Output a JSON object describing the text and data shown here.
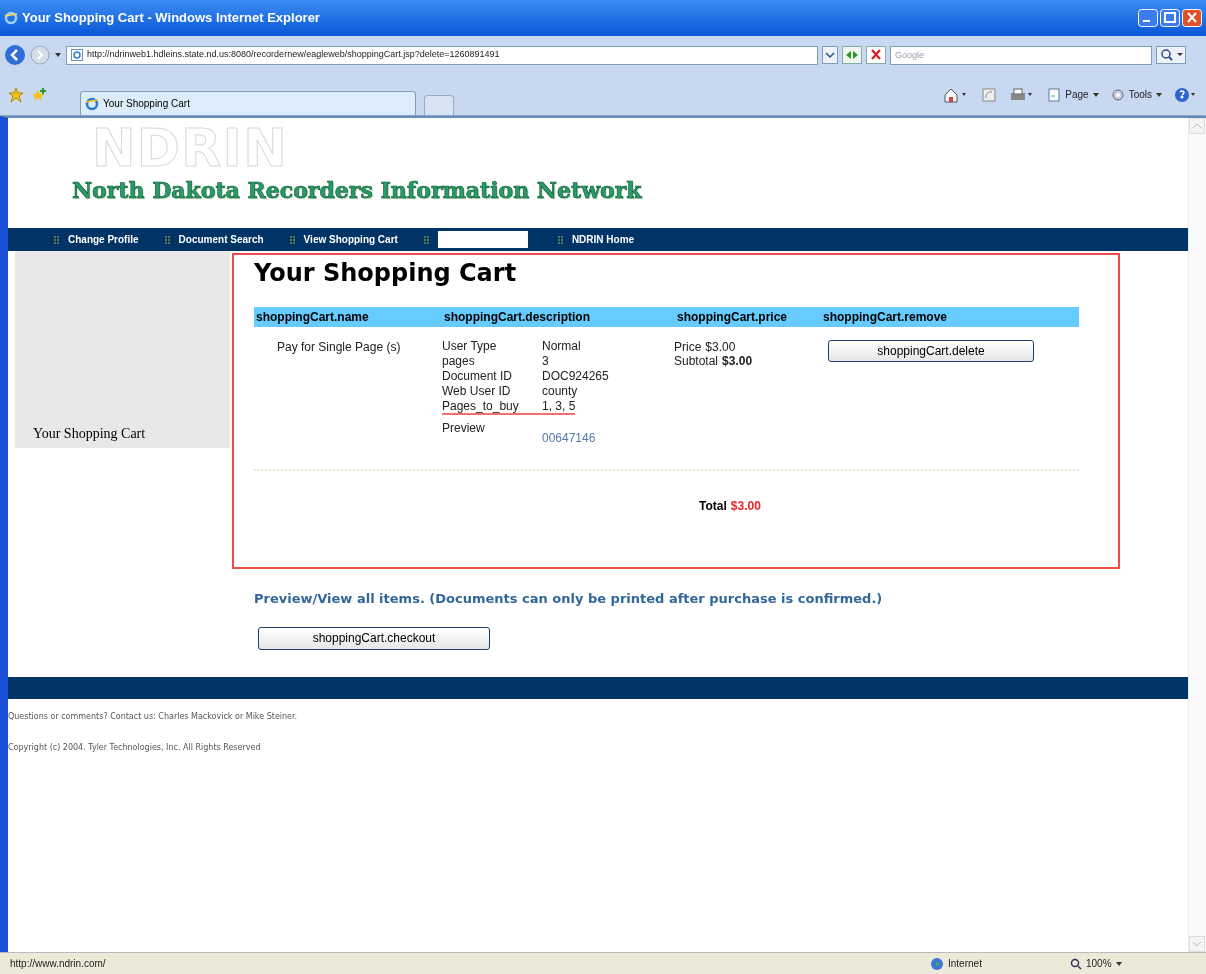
{
  "window": {
    "title": "Your Shopping Cart - Windows Internet Explorer"
  },
  "toolbar": {
    "address": "http://ndrinweb1.hdleins.state.nd.us:8080/recordernew/eagleweb/shoppingCart.jsp?delete=1260891491",
    "search_placeholder": "Google"
  },
  "tabs": [
    {
      "label": "Your Shopping Cart",
      "selected": true
    }
  ],
  "commands": [
    "Page",
    "Tools"
  ],
  "site": {
    "logo_mark": "NDRIN",
    "title": "North Dakota Recorders Information Network"
  },
  "nav": [
    {
      "kind": "link",
      "label": "Change Profile"
    },
    {
      "kind": "link",
      "label": "Document Search"
    },
    {
      "kind": "link",
      "label": "View Shopping Cart"
    },
    {
      "kind": "blank"
    },
    {
      "kind": "link",
      "label": "NDRIN Home"
    }
  ],
  "sidebar": {
    "label": "Your Shopping Cart"
  },
  "cart": {
    "heading": "Your Shopping Cart",
    "columns": [
      "shoppingCart.name",
      "shoppingCart.description",
      "shoppingCart.price",
      "shoppingCart.remove"
    ],
    "items": [
      {
        "name": "Pay for Single Page (s)",
        "details": [
          {
            "label": "User Type",
            "value": "Normal",
            "underlined": false
          },
          {
            "label": "pages",
            "value": "3",
            "underlined": false
          },
          {
            "label": "Document ID",
            "value": "DOC924265",
            "underlined": false
          },
          {
            "label": "Web User ID",
            "value": "county",
            "underlined": false
          },
          {
            "label": "Pages_to_buy",
            "value": "1, 3, 5",
            "underlined": true
          }
        ],
        "preview_label": "Preview",
        "preview_link": "00647146",
        "price_label": "Price",
        "price": "$3.00",
        "subtotal_label": "Subtotal",
        "subtotal": "$3.00",
        "button": "shoppingCart.delete"
      }
    ],
    "total_label": "Total",
    "total": "$3.00"
  },
  "note": "Preview/View all items. (Documents can only be printed after purchase is confirmed.)",
  "checkout_button": "shoppingCart.checkout",
  "footer": [
    "Questions or comments? Contact us: Charles Mackovick or Mike Steiner.",
    "Copyright (c) 2004. Tyler Technologies, Inc. All Rights Reserved"
  ],
  "status_bar": {
    "url": "http://www.ndrin.com/",
    "zone": "Internet",
    "zoom": "100%"
  }
}
